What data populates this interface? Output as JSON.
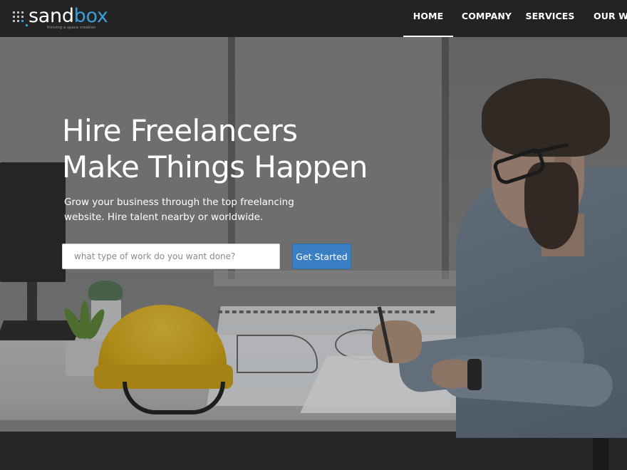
{
  "header": {
    "logo": {
      "word_part1": "sand",
      "word_part2": "box",
      "tagline": "thriving a space creation"
    },
    "nav": {
      "items": [
        {
          "label": "HOME",
          "active": true
        },
        {
          "label": "COMPANY",
          "active": false
        },
        {
          "label": "SERVICES",
          "active": false
        },
        {
          "label": "OUR WO",
          "active": false
        }
      ]
    }
  },
  "hero": {
    "title_line1": "Hire Freelancers",
    "title_line2": "Make Things Happen",
    "subtitle_line1": "Grow your business through the top freelancing",
    "subtitle_line2": "website. Hire talent nearby or worldwide.",
    "search": {
      "placeholder": "what type of work do you want done?",
      "value": ""
    },
    "cta_label": "Get Started",
    "background_image": "man-reviewing-blueprints-at-desk-with-hard-hat"
  },
  "colors": {
    "header_bg": "#212121",
    "brand_blue": "#39a0dc",
    "cta_blue": "#3a7fc3",
    "text_white": "#ffffff"
  }
}
